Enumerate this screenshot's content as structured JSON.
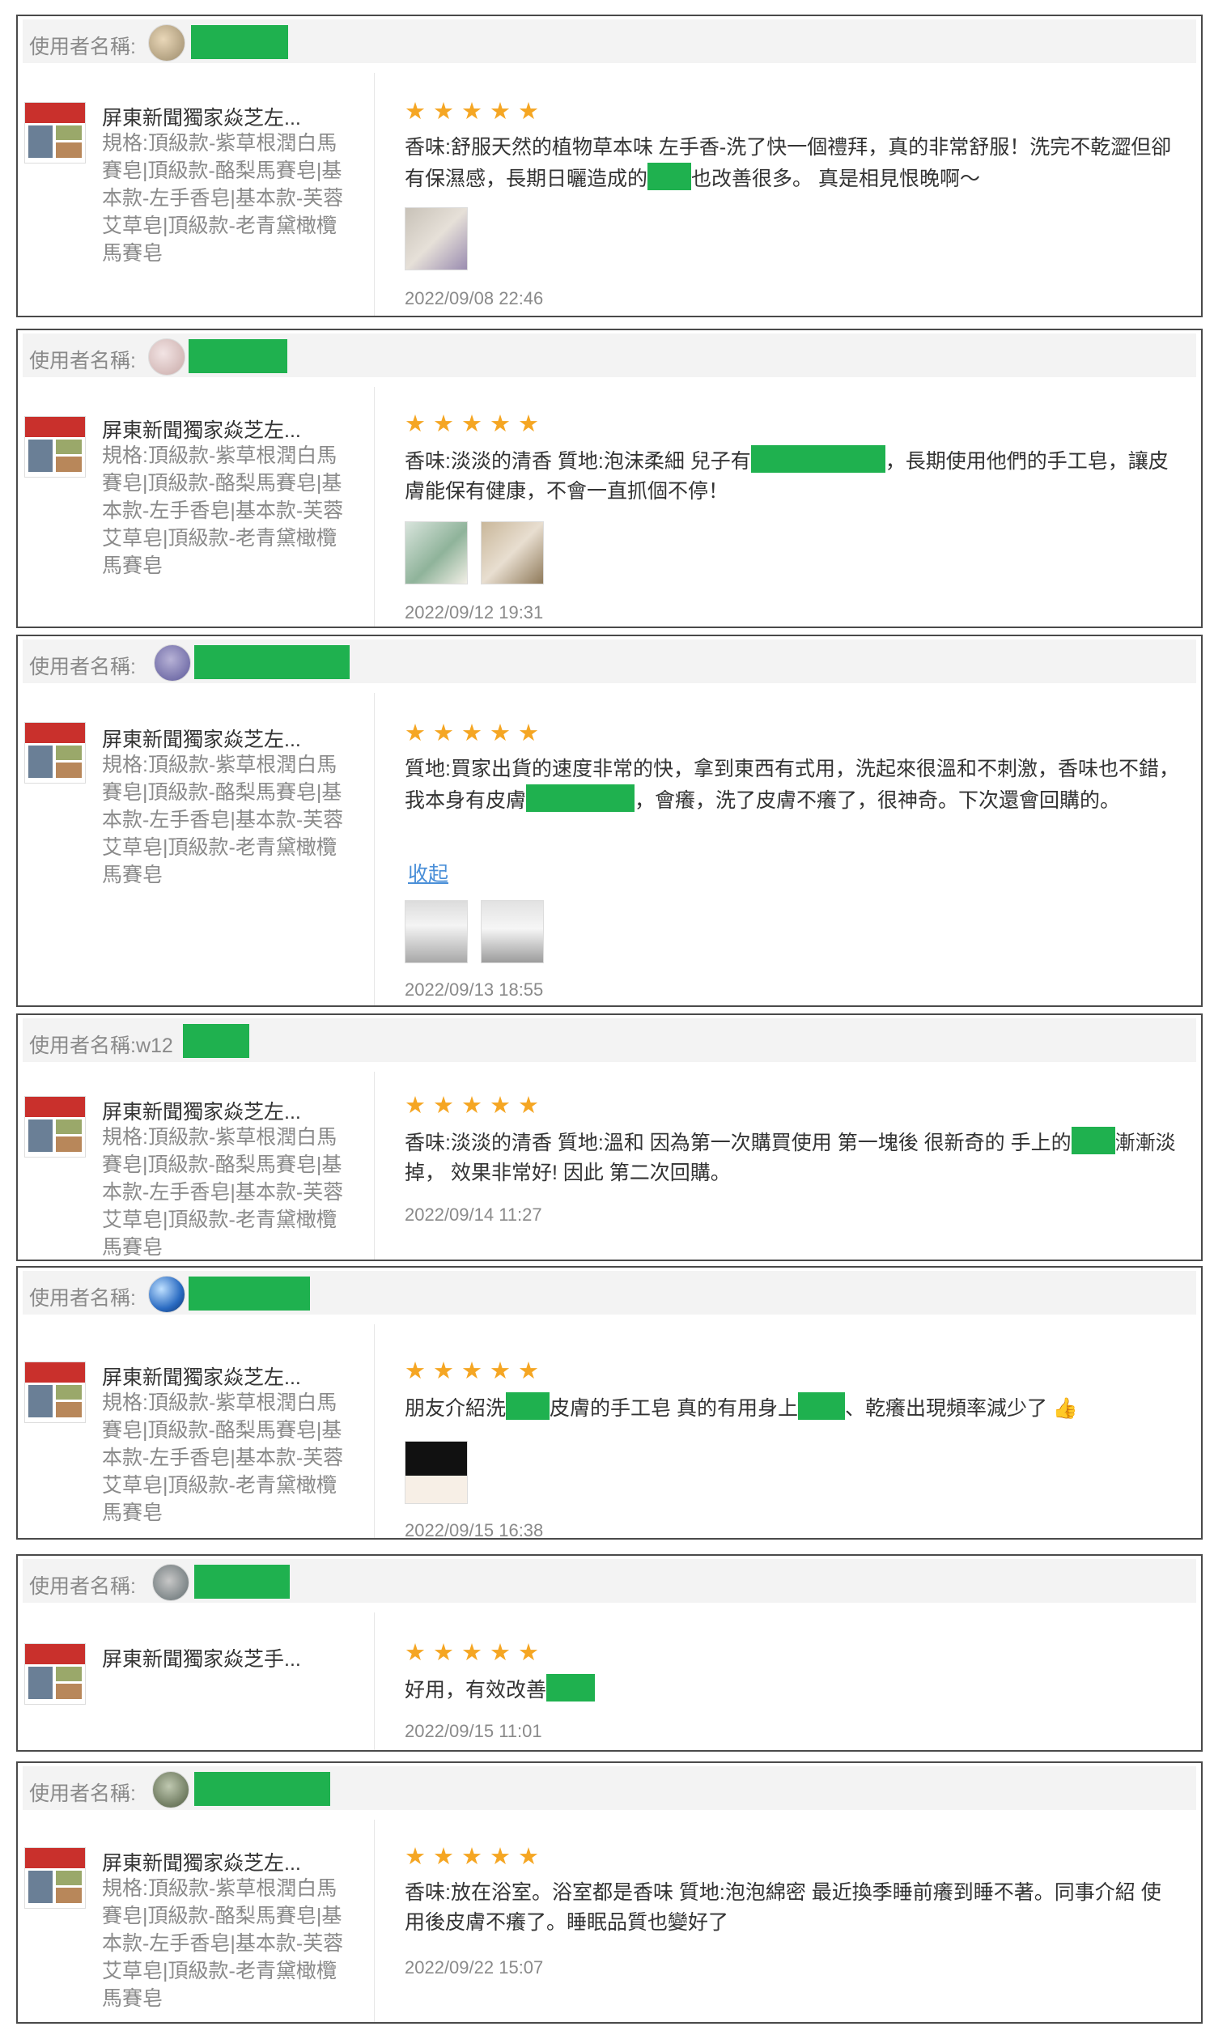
{
  "label": "使用者名稱:",
  "reviews": [
    {
      "user_suffix": "",
      "product_name": "屏東新聞獨家焱芝左...",
      "spec": "規格:頂級款-紫草根潤白馬賽皂|頂級款-酪梨馬賽皂|基本款-左手香皂|基本款-芙蓉艾草皂|頂級款-老青黛橄欖馬賽皂",
      "stars": "★★★★★",
      "text1": "香味:舒服天然的植物草本味 左手香-洗了快一個禮拜，真的非常舒服！洗完不乾澀但卻有保濕感，長期日曬造成的",
      "text2": "也改善很多。 真是相見恨晚啊～",
      "date": "2022/09/08 22:46"
    },
    {
      "user_suffix": "",
      "product_name": "屏東新聞獨家焱芝左...",
      "spec": "規格:頂級款-紫草根潤白馬賽皂|頂級款-酪梨馬賽皂|基本款-左手香皂|基本款-芙蓉艾草皂|頂級款-老青黛橄欖馬賽皂",
      "stars": "★★★★★",
      "text1": "香味:淡淡的清香 質地:泡沫柔細 兒子有",
      "text2": "，長期使用他們的手工皂，讓皮膚能保有健康，不會一直抓個不停！",
      "date": "2022/09/12 19:31"
    },
    {
      "user_suffix": "",
      "product_name": "屏東新聞獨家焱芝左...",
      "spec": "規格:頂級款-紫草根潤白馬賽皂|頂級款-酪梨馬賽皂|基本款-左手香皂|基本款-芙蓉艾草皂|頂級款-老青黛橄欖馬賽皂",
      "stars": "★★★★★",
      "text1": "質地:買家出貨的速度非常的快，拿到東西有式用，洗起來很溫和不刺激，香味也不錯，我本身有皮膚",
      "text2": "，會癢，洗了皮膚不癢了，很神奇。下次還會回購的。",
      "collapse": "收起",
      "date": "2022/09/13 18:55"
    },
    {
      "user_suffix": "w12",
      "product_name": "屏東新聞獨家焱芝左...",
      "spec": "規格:頂級款-紫草根潤白馬賽皂|頂級款-酪梨馬賽皂|基本款-左手香皂|基本款-芙蓉艾草皂|頂級款-老青黛橄欖馬賽皂",
      "stars": "★★★★★",
      "text1": "香味:淡淡的清香 質地:溫和 因為第一次購買使用 第一塊後 很新奇的 手上的",
      "text2": "漸漸淡掉， 效果非常好! 因此 第二次回購。",
      "date": "2022/09/14 11:27"
    },
    {
      "user_suffix": "",
      "product_name": "屏東新聞獨家焱芝左...",
      "spec": "規格:頂級款-紫草根潤白馬賽皂|頂級款-酪梨馬賽皂|基本款-左手香皂|基本款-芙蓉艾草皂|頂級款-老青黛橄欖馬賽皂",
      "stars": "★★★★★",
      "text1": "朋友介紹洗",
      "text2": "皮膚的手工皂 真的有用身上",
      "text3": "、乾癢出現頻率減少了 👍",
      "date": "2022/09/15 16:38"
    },
    {
      "user_suffix": "",
      "product_name": "屏東新聞獨家焱芝手...",
      "spec": "",
      "stars": "★★★★★",
      "text1": "好用，有效改善",
      "text2": "",
      "date": "2022/09/15 11:01"
    },
    {
      "user_suffix": "",
      "product_name": "屏東新聞獨家焱芝左...",
      "spec": "規格:頂級款-紫草根潤白馬賽皂|頂級款-酪梨馬賽皂|基本款-左手香皂|基本款-芙蓉艾草皂|頂級款-老青黛橄欖馬賽皂",
      "stars": "★★★★★",
      "text1": "香味:放在浴室。浴室都是香味 質地:泡泡綿密 最近換季睡前癢到睡不著。同事介紹 使用後皮膚不癢了。睡眠品質也變好了",
      "text2": "",
      "date": "2022/09/22 15:07"
    }
  ],
  "colors": {
    "star": "#f5a623",
    "redaction": "#1fb14f",
    "link": "#4a8fd8",
    "border": "#4a4a4a"
  }
}
